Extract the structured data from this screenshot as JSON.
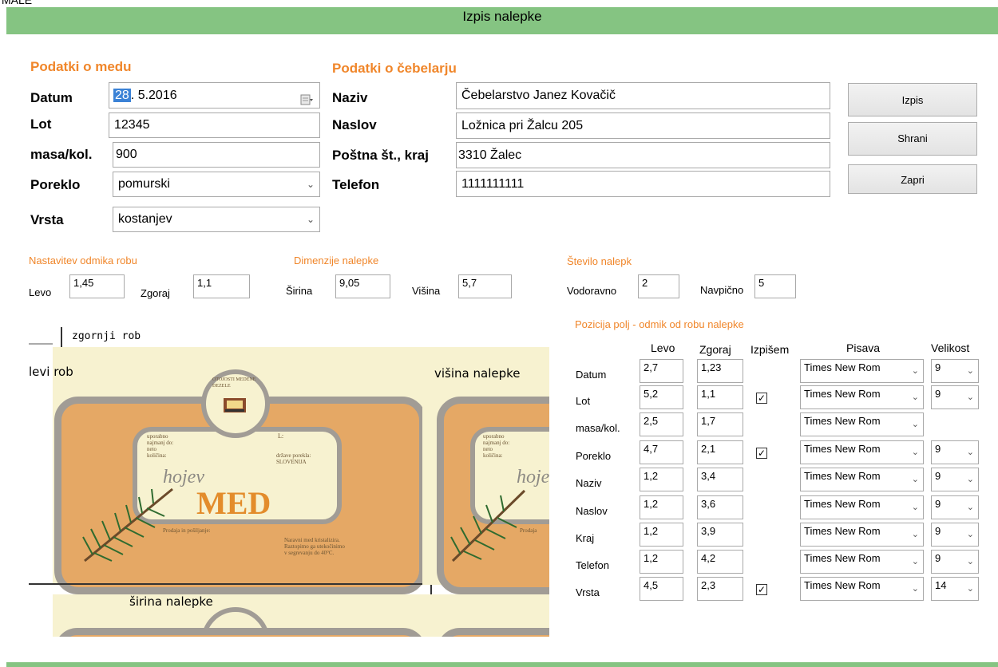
{
  "window": {
    "title": "Izpis nalepke",
    "corner_text": "MALE"
  },
  "honey": {
    "section_title": "Podatki o medu",
    "date_label": "Datum",
    "date_day": "28",
    "date_rest": ". 5.2016",
    "lot_label": "Lot",
    "lot_value": "12345",
    "mass_label": "masa/kol.",
    "mass_value": "900",
    "origin_label": "Poreklo",
    "origin_value": "pomurski",
    "type_label": "Vrsta",
    "type_value": "kostanjev"
  },
  "beekeeper": {
    "section_title": "Podatki o čebelarju",
    "name_label": "Naziv",
    "name_value": "Čebelarstvo Janez Kovačič",
    "address_label": "Naslov",
    "address_value": "Ložnica pri Žalcu 205",
    "post_label": "Poštna št., kraj",
    "post_value": "3310 Žalec",
    "phone_label": "Telefon",
    "phone_value": "1111111111"
  },
  "buttons": {
    "print": "Izpis",
    "save": "Shrani",
    "close": "Zapri"
  },
  "margins": {
    "title": "Nastavitev odmika robu",
    "left_label": "Levo",
    "left_value": "1,45",
    "top_label": "Zgoraj",
    "top_value": "1,1"
  },
  "dimensions": {
    "title": "Dimenzije nalepke",
    "width_label": "Širina",
    "width_value": "9,05",
    "height_label": "Višina",
    "height_value": "5,7"
  },
  "count": {
    "title": "Število nalepk",
    "horiz_label": "Vodoravno",
    "horiz_value": "2",
    "vert_label": "Navpično",
    "vert_value": "5"
  },
  "preview": {
    "top_edge": "zgornji rob",
    "left_edge": "levi rob",
    "label_height": "višina nalepke",
    "label_width": "širina nalepke",
    "seal_text": "OTOJOSTI MEDENE DEZELE",
    "l_mark": "L:",
    "small_left": "uporabno\nnajmanj do:\nneto\nkoličina:",
    "small_right": "države porekla:\nSLOVENIJA",
    "hojev": "hojev",
    "med": "MED",
    "sold": "Prodaja in pošiljanje:",
    "notice": "Naravni med kristalizira.\nRaztopimo ga utekočinimo\nv segrevanju do 40°C.",
    "cut_left": "uporabno\nnajmanj do:\nneto\nkoličina:",
    "cut_hojev": "hojev",
    "cut_sold": "Prodaja"
  },
  "positions": {
    "title": "Pozicija polj - odmik od robu nalepke",
    "headers": {
      "left": "Levo",
      "top": "Zgoraj",
      "print": "Izpišem",
      "font": "Pisava",
      "size": "Velikost"
    },
    "rows": [
      {
        "name": "Datum",
        "left": "2,7",
        "top": "1,23",
        "print": false,
        "font": "Times New Rom",
        "size": "9"
      },
      {
        "name": "Lot",
        "left": "5,2",
        "top": "1,1",
        "print": true,
        "font": "Times New Rom",
        "size": "9"
      },
      {
        "name": "masa/kol.",
        "left": "2,5",
        "top": "1,7",
        "print": false,
        "font": "Times New Rom",
        "size": ""
      },
      {
        "name": "Poreklo",
        "left": "4,7",
        "top": "2,1",
        "print": true,
        "font": "Times New Rom",
        "size": "9"
      },
      {
        "name": "Naziv",
        "left": "1,2",
        "top": "3,4",
        "print": false,
        "font": "Times New Rom",
        "size": "9"
      },
      {
        "name": "Naslov",
        "left": "1,2",
        "top": "3,6",
        "print": false,
        "font": "Times New Rom",
        "size": "9"
      },
      {
        "name": "Kraj",
        "left": "1,2",
        "top": "3,9",
        "print": false,
        "font": "Times New Rom",
        "size": "9"
      },
      {
        "name": "Telefon",
        "left": "1,2",
        "top": "4,2",
        "print": false,
        "font": "Times New Rom",
        "size": "9"
      },
      {
        "name": "Vrsta",
        "left": "4,5",
        "top": "2,3",
        "print": true,
        "font": "Times New Rom",
        "size": "14"
      }
    ]
  },
  "colors": {
    "titlebar": "#85c482",
    "accent": "#f0862a",
    "label_bg": "#f7f2d0",
    "label_frame": "#a19c95",
    "label_orange": "#e5a865"
  }
}
